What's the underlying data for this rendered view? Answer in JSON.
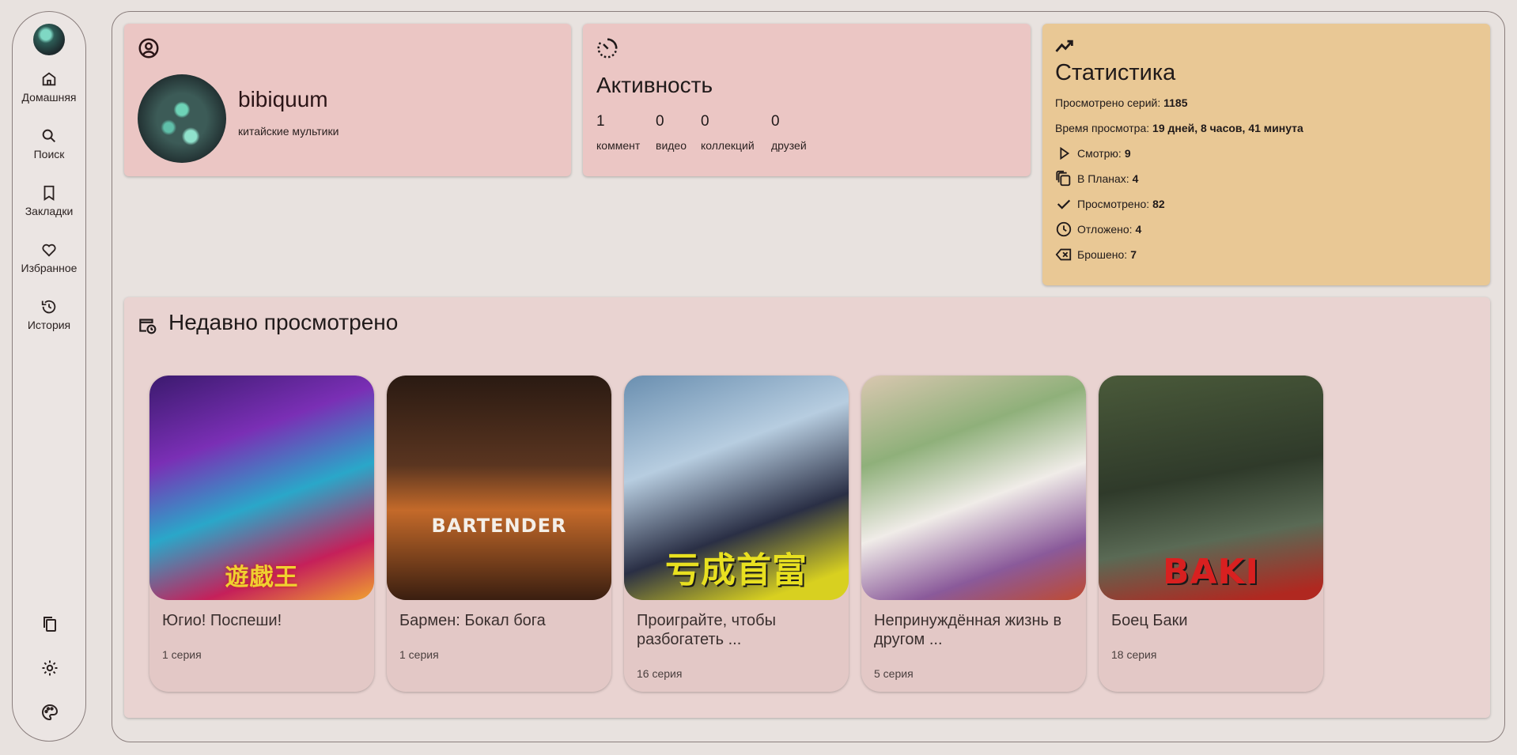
{
  "nav": {
    "items": [
      {
        "label": "Домашняя",
        "icon": "home-icon"
      },
      {
        "label": "Поиск",
        "icon": "search-icon"
      },
      {
        "label": "Закладки",
        "icon": "bookmark-icon"
      },
      {
        "label": "Избранное",
        "icon": "heart-icon"
      },
      {
        "label": "История",
        "icon": "history-icon"
      }
    ],
    "bottom_icons": [
      "copy-icon",
      "settings-icon",
      "palette-icon"
    ]
  },
  "profile": {
    "username": "bibiquum",
    "bio": "китайские мультики"
  },
  "activity": {
    "title": "Активность",
    "stats": [
      {
        "value": "1",
        "label": "коммент"
      },
      {
        "value": "0",
        "label": "видео"
      },
      {
        "value": "0",
        "label": "коллекций"
      },
      {
        "value": "0",
        "label": "друзей"
      }
    ]
  },
  "statistics": {
    "title": "Статистика",
    "episodes_label": "Просмотрено серий:",
    "episodes_value": "1185",
    "time_label": "Время просмотра:",
    "time_value": "19 дней, 8 часов, 41 минута",
    "statuses": [
      {
        "label": "Смотрю:",
        "value": "9",
        "icon": "play-icon"
      },
      {
        "label": "В Планах:",
        "value": "4",
        "icon": "stack-icon"
      },
      {
        "label": "Просмотрено:",
        "value": "82",
        "icon": "check-icon"
      },
      {
        "label": "Отложено:",
        "value": "4",
        "icon": "clock-icon"
      },
      {
        "label": "Брошено:",
        "value": "7",
        "icon": "backspace-icon"
      }
    ]
  },
  "recent": {
    "title": "Недавно просмотрено",
    "items": [
      {
        "title": "Югио! Поспеши!",
        "episodes": "1 серия",
        "poster_text": "遊戯王"
      },
      {
        "title": "Бармен: Бокал бога",
        "episodes": "1 серия",
        "poster_text": "BARTENDER"
      },
      {
        "title": "Проиграйте, чтобы разбогатеть ...",
        "episodes": "16 серия",
        "poster_text": "亏成首富"
      },
      {
        "title": "Непринуждённая жизнь в другом ...",
        "episodes": "5 серия",
        "poster_text": ""
      },
      {
        "title": "Боец Баки",
        "episodes": "18 серия",
        "poster_text": "BAKI"
      }
    ]
  },
  "colors": {
    "background": "#e8e2df",
    "profile_card": "#ebc6c4",
    "stats_card": "#e9c895",
    "recent_card": "#e9d3d1"
  }
}
